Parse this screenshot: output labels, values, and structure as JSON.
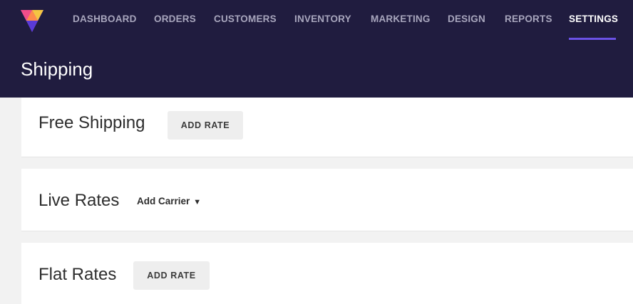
{
  "nav": {
    "items": [
      {
        "label": "DASHBOARD"
      },
      {
        "label": "ORDERS"
      },
      {
        "label": "CUSTOMERS"
      },
      {
        "label": "INVENTORY"
      },
      {
        "label": "MARKETING"
      },
      {
        "label": "DESIGN"
      },
      {
        "label": "REPORTS"
      },
      {
        "label": "SETTINGS",
        "active": true
      }
    ],
    "active_color": "#6b52e6"
  },
  "page": {
    "title": "Shipping"
  },
  "sections": {
    "free_shipping": {
      "title": "Free Shipping",
      "button_label": "ADD RATE"
    },
    "live_rates": {
      "title": "Live Rates",
      "dropdown_label": "Add Carrier",
      "dropdown_icon": "caret-down-icon"
    },
    "flat_rates": {
      "title": "Flat Rates",
      "button_label": "ADD RATE"
    }
  },
  "colors": {
    "header_bg": "#201c3f",
    "page_bg": "#f2f2f2"
  }
}
